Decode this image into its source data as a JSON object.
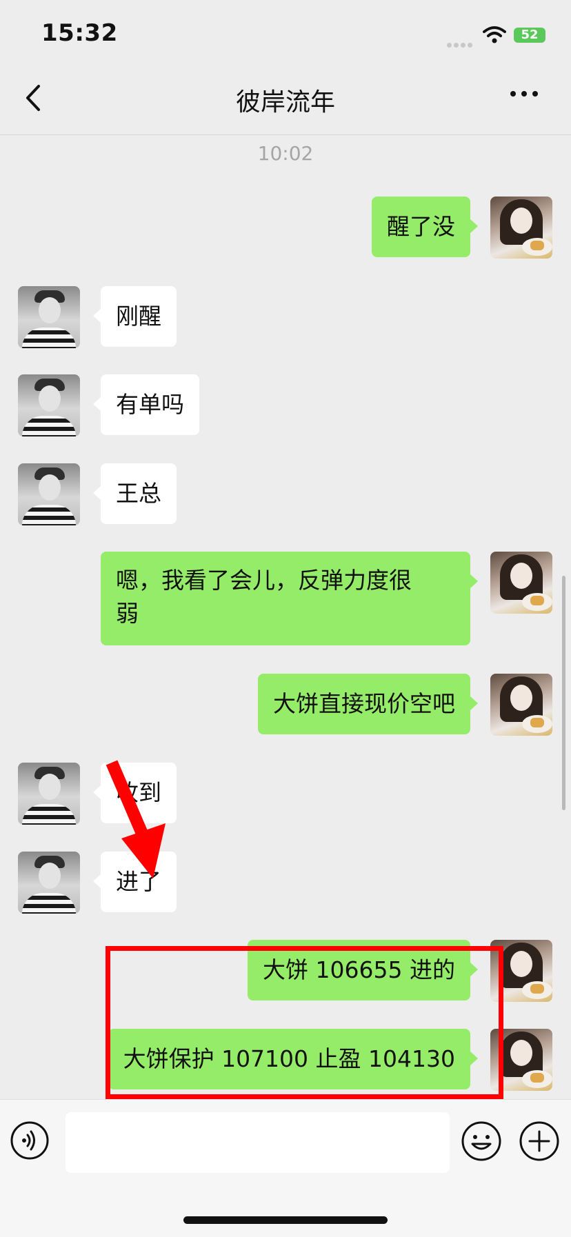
{
  "status_bar": {
    "time": "15:32",
    "battery": "52"
  },
  "nav": {
    "title": "彼岸流年"
  },
  "timestamp": "10:02",
  "messages": [
    {
      "side": "right",
      "text": "醒了没"
    },
    {
      "side": "left",
      "text": "刚醒"
    },
    {
      "side": "left",
      "text": "有单吗"
    },
    {
      "side": "left",
      "text": "王总"
    },
    {
      "side": "right",
      "text": "嗯，我看了会儿，反弹力度很\n弱"
    },
    {
      "side": "right",
      "text": "大饼直接现价空吧"
    },
    {
      "side": "left",
      "text": "收到"
    },
    {
      "side": "left",
      "text": "进了"
    },
    {
      "side": "right",
      "text": "大饼 106655 进的"
    },
    {
      "side": "right",
      "text": "大饼保护 107100 止盈 104130"
    }
  ],
  "input": {
    "value": "",
    "placeholder": ""
  },
  "colors": {
    "sent_bubble": "#95ec69",
    "received_bubble": "#ffffff",
    "annotation": "#ff0000",
    "background": "#ededed"
  },
  "icons": [
    "back-icon",
    "more-icon",
    "voice-icon",
    "emoji-icon",
    "plus-icon",
    "wifi-icon",
    "battery-icon"
  ]
}
